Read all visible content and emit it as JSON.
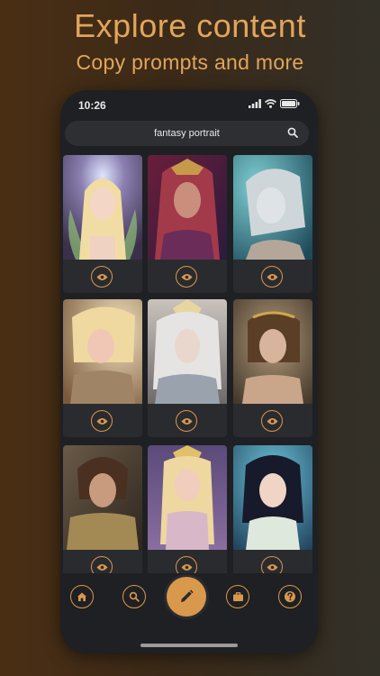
{
  "headline": {
    "title": "Explore content",
    "subtitle": "Copy prompts and more"
  },
  "status_bar": {
    "time": "10:26"
  },
  "search": {
    "value": "fantasy portrait"
  },
  "colors": {
    "accent": "#d8994c",
    "headline": "#e2a55a",
    "phone_bg": "#1f2023",
    "card_bg": "#2a2b2f"
  },
  "grid": {
    "cards": [
      {
        "label": "elf portrait with halo",
        "action_icon": "eye-icon"
      },
      {
        "label": "crimson haired sorceress",
        "action_icon": "eye-icon"
      },
      {
        "label": "pale elf with face markings",
        "action_icon": "eye-icon"
      },
      {
        "label": "golden haired warrior",
        "action_icon": "eye-icon"
      },
      {
        "label": "silver haired armored knight",
        "action_icon": "eye-icon"
      },
      {
        "label": "brunette with gold tiara",
        "action_icon": "eye-icon"
      },
      {
        "label": "curly haired warrior in gold",
        "action_icon": "eye-icon"
      },
      {
        "label": "blonde elf queen",
        "action_icon": "eye-icon"
      },
      {
        "label": "dark haired princess",
        "action_icon": "eye-icon"
      }
    ]
  },
  "tabbar": {
    "items": [
      "home-icon",
      "search-icon",
      "pencil-icon",
      "briefcase-icon",
      "help-icon"
    ]
  }
}
